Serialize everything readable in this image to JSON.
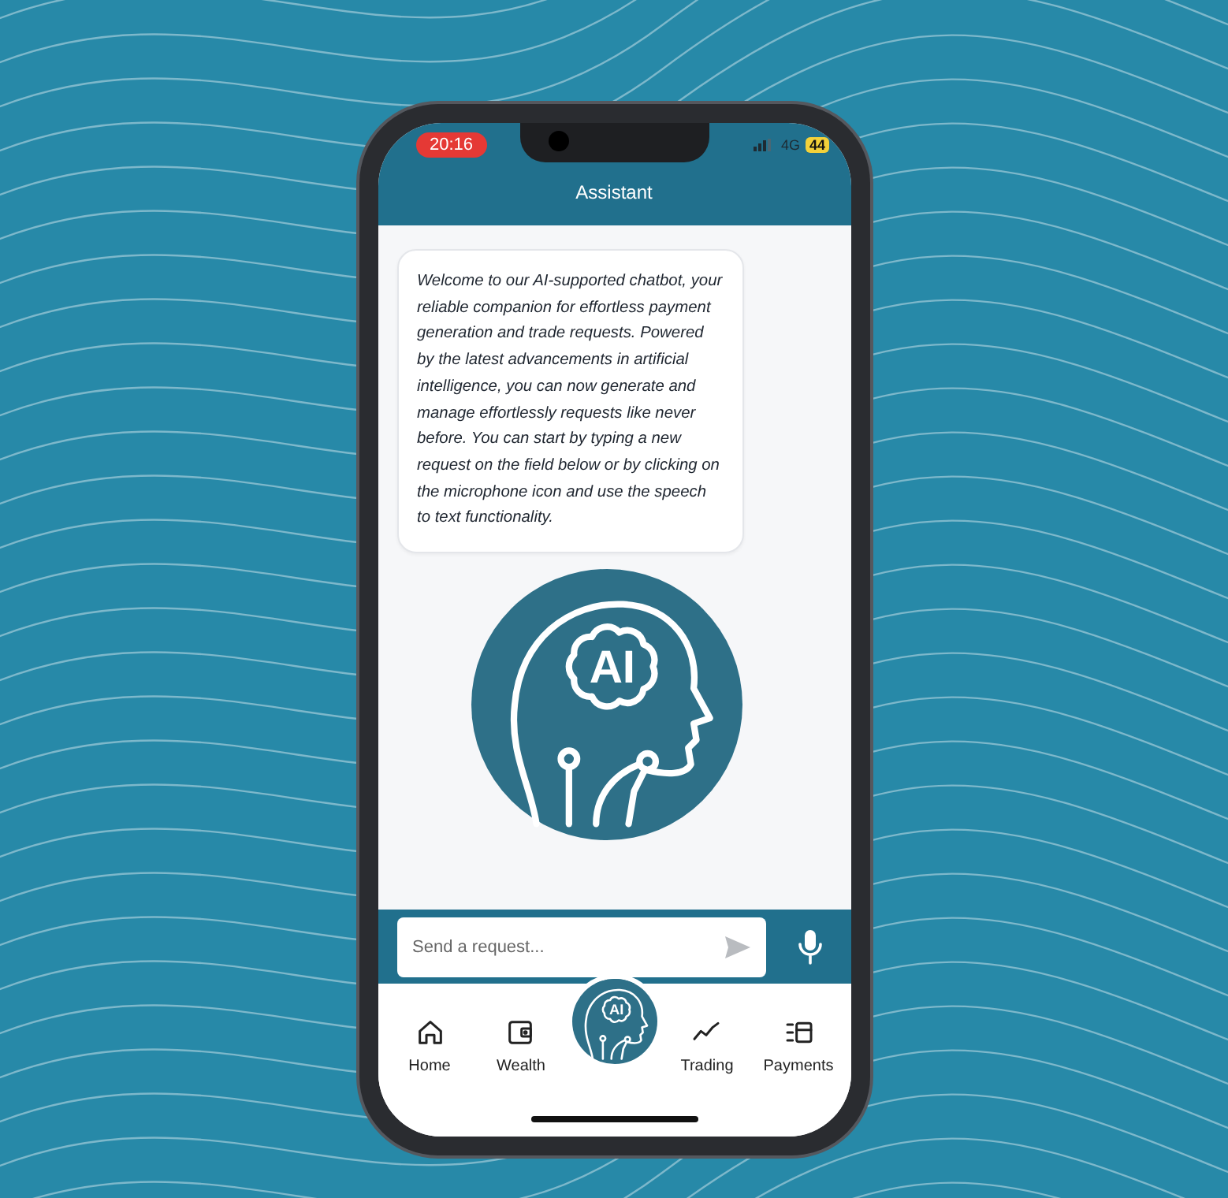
{
  "status_bar": {
    "time": "20:16",
    "network": "4G",
    "battery": "44"
  },
  "header": {
    "title": "Assistant"
  },
  "messages": [
    {
      "text": "Welcome to our AI-supported chatbot, your reliable companion for effortless payment generation and trade requests. Powered by the latest advancements in artificial intelligence, you can now generate and manage effortlessly requests like never before. You can start by typing a new request on the field below or by clicking on the microphone icon and use the speech to text functionality."
    }
  ],
  "illustration": {
    "label": "AI"
  },
  "composer": {
    "placeholder": "Send a request..."
  },
  "nav": {
    "items": [
      {
        "kind": "home",
        "label": "Home"
      },
      {
        "kind": "wallet",
        "label": "Wealth"
      },
      {
        "kind": "logo",
        "label": "AI"
      },
      {
        "kind": "trading",
        "label": "Trading"
      },
      {
        "kind": "payments",
        "label": "Payments"
      }
    ]
  }
}
